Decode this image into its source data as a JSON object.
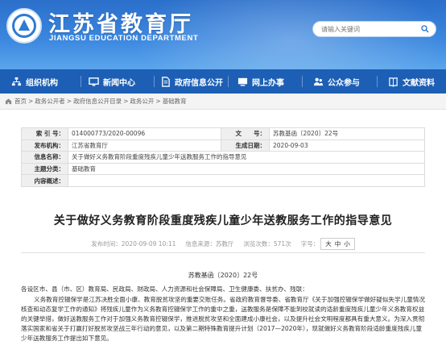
{
  "header": {
    "title": "江苏省教育厅",
    "subtitle": "JIANGSU EDUCATION DEPARTMENT",
    "search_placeholder": "请输入关键词"
  },
  "nav": {
    "items": [
      {
        "label": "组织机构",
        "icon": "org-chart-icon"
      },
      {
        "label": "新闻中心",
        "icon": "monitor-icon"
      },
      {
        "label": "政府信息公开",
        "icon": "document-icon"
      },
      {
        "label": "网上办事",
        "icon": "screen-icon"
      },
      {
        "label": "公众参与",
        "icon": "people-icon"
      },
      {
        "label": "文献资料",
        "icon": "book-icon"
      }
    ]
  },
  "breadcrumb": [
    "首页",
    "政务公开者",
    "政府信息公开目录",
    "政务公开",
    "基础教育"
  ],
  "info": {
    "index_label": "索 引 号：",
    "index_value": "014000773/2020-00096",
    "docnum_label": "文　　号：",
    "docnum_value": "苏教基函〔2020〕22号",
    "org_label": "发布机构：",
    "org_value": "江苏省教育厅",
    "date_label": "生成日期：",
    "date_value": "2020-09-03",
    "name_label": "信息名称：",
    "name_value": "关于做好义务教育阶段重度残疾儿童少年送教服务工作的指导意见",
    "topic_label": "主题分类：",
    "topic_value": "基础教育",
    "summary_label": "内容概述：",
    "summary_value": ""
  },
  "article": {
    "title": "关于做好义务教育阶段重度残疾儿童少年送教服务工作的指导意见",
    "published": "发布时间：2020-09-09 10:11",
    "source": "信息来源：苏教厅",
    "views": "浏览次数：571次",
    "font_label": "字号：",
    "font_large": "大",
    "font_medium": "中",
    "font_small": "小",
    "doc_number": "苏教基函〔2020〕22号",
    "salutation": "各设区市、县（市、区）教育局、民政局、财政局、人力资源和社会保障局、卫生健康委、扶贫办、残联：",
    "para1": "义务教育控辍保学是江苏决胜全面小康、教育脱贫攻坚的重要交账任务。省政府教育督导委、省教育厅《关于加强控辍保学做好疑似失学儿童情况核查和动态复学工作的通知》将残疾儿童作为义务教育控辍保学工作的重中之重，送教服务是保障不能到校就读的适龄重度残疾儿童少年义务教育权益的关键举措，做好送教服务工作对于加强义务教育控辍保学，推进脱贫攻坚和全面建成小康社会，以及提升社会文明程度都具有重大意义。为深入贯彻落实国家和省关于打赢打好脱贫攻坚战三年行动的意见，以及第二期特殊教育提升计划（2017—2020年），现就做好义务教育阶段适龄重度残疾儿童少年送教服务工作提出如下意见。"
  },
  "colors": {
    "header_top": "#2b6fcb",
    "nav_bg": "#1d5fb5",
    "label_bg": "#efefef"
  }
}
